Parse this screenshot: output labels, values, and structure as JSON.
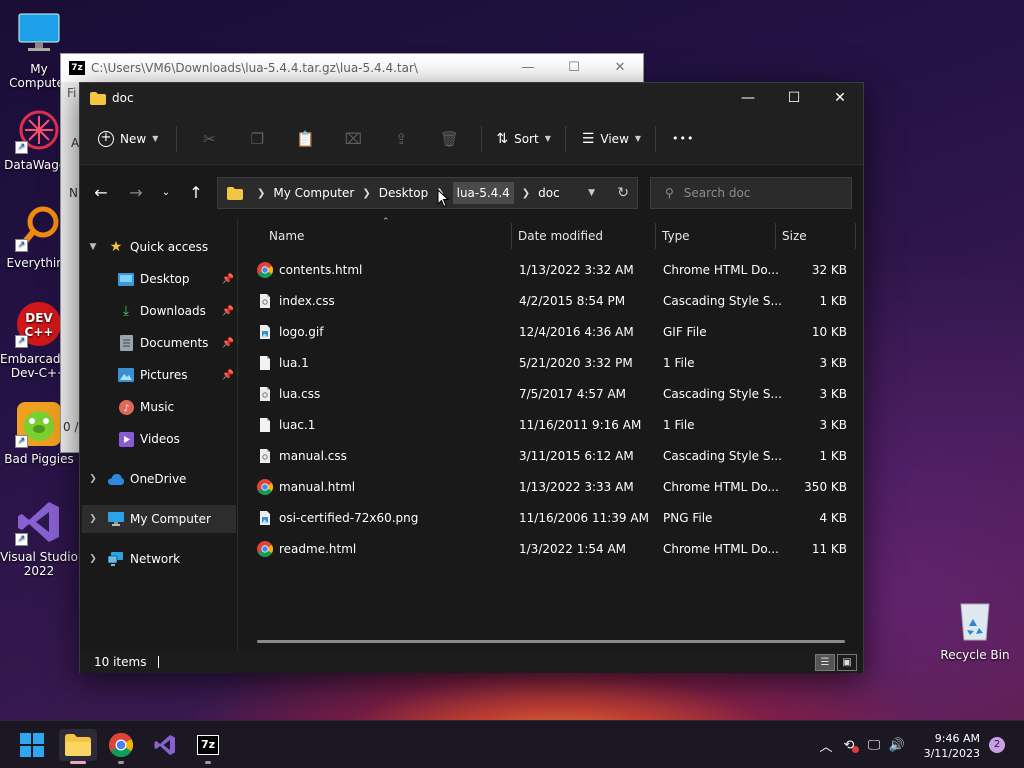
{
  "desktop": {
    "icons": [
      {
        "label": "My Computer",
        "icon": "monitor-icon"
      },
      {
        "label": "DataWagon",
        "icon": "datawagon-icon"
      },
      {
        "label": "Everything",
        "icon": "search-loupe-icon"
      },
      {
        "label": "Embarcadero Dev-C++",
        "icon": "devcpp-icon"
      },
      {
        "label": "Bad Piggies",
        "icon": "badpiggies-icon"
      },
      {
        "label": "Visual Studio 2022",
        "icon": "visualstudio-icon"
      },
      {
        "label": "Recycle Bin",
        "icon": "recycle-bin-icon"
      }
    ]
  },
  "background_window": {
    "title": "C:\\Users\\VM6\\Downloads\\lua-5.4.4.tar.gz\\lua-5.4.4.tar\\",
    "snippets": [
      "Fi",
      "A",
      "N",
      "0 /"
    ]
  },
  "explorer": {
    "title": "doc",
    "toolbar": {
      "new_label": "New",
      "sort_label": "Sort",
      "view_label": "View",
      "more_label": "•••",
      "tools": [
        "cut-icon",
        "copy-icon",
        "paste-icon",
        "rename-icon",
        "share-icon",
        "delete-icon"
      ]
    },
    "breadcrumb": [
      "My Computer",
      "Desktop",
      "lua-5.4.4",
      "doc"
    ],
    "search_placeholder": "Search doc",
    "nav": {
      "quick_access": "Quick access",
      "desktop": "Desktop",
      "downloads": "Downloads",
      "documents": "Documents",
      "pictures": "Pictures",
      "music": "Music",
      "videos": "Videos",
      "onedrive": "OneDrive",
      "my_computer": "My Computer",
      "network": "Network"
    },
    "columns": {
      "name": "Name",
      "date": "Date modified",
      "type": "Type",
      "size": "Size"
    },
    "files": [
      {
        "name": "contents.html",
        "date": "1/13/2022 3:32 AM",
        "type": "Chrome HTML Do...",
        "size": "32 KB",
        "icon": "chrome"
      },
      {
        "name": "index.css",
        "date": "4/2/2015 8:54 PM",
        "type": "Cascading Style S...",
        "size": "1 KB",
        "icon": "css"
      },
      {
        "name": "logo.gif",
        "date": "12/4/2016 4:36 AM",
        "type": "GIF File",
        "size": "10 KB",
        "icon": "image"
      },
      {
        "name": "lua.1",
        "date": "5/21/2020 3:32 PM",
        "type": "1 File",
        "size": "3 KB",
        "icon": "file"
      },
      {
        "name": "lua.css",
        "date": "7/5/2017 4:57 AM",
        "type": "Cascading Style S...",
        "size": "3 KB",
        "icon": "css"
      },
      {
        "name": "luac.1",
        "date": "11/16/2011 9:16 AM",
        "type": "1 File",
        "size": "3 KB",
        "icon": "file"
      },
      {
        "name": "manual.css",
        "date": "3/11/2015 6:12 AM",
        "type": "Cascading Style S...",
        "size": "1 KB",
        "icon": "css"
      },
      {
        "name": "manual.html",
        "date": "1/13/2022 3:33 AM",
        "type": "Chrome HTML Do...",
        "size": "350 KB",
        "icon": "chrome"
      },
      {
        "name": "osi-certified-72x60.png",
        "date": "11/16/2006 11:39 AM",
        "type": "PNG File",
        "size": "4 KB",
        "icon": "image"
      },
      {
        "name": "readme.html",
        "date": "1/3/2022 1:54 AM",
        "type": "Chrome HTML Do...",
        "size": "11 KB",
        "icon": "chrome"
      }
    ],
    "status": "10 items"
  },
  "taskbar": {
    "time": "9:46 AM",
    "date": "3/11/2023",
    "notifications": "2",
    "apps": [
      "start-icon",
      "file-explorer-icon",
      "chrome-icon",
      "visual-studio-icon",
      "7zip-icon"
    ]
  }
}
